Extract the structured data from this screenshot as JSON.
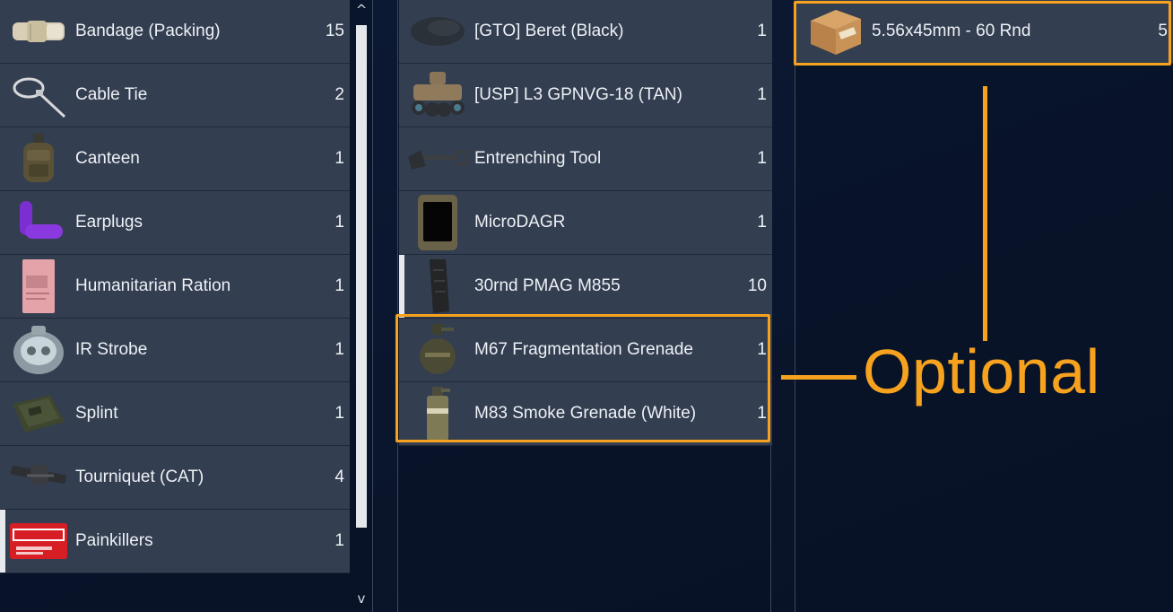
{
  "left_panel": {
    "items": [
      {
        "icon": "bandage-icon",
        "label": "Bandage (Packing)",
        "qty": "15"
      },
      {
        "icon": "cable-tie-icon",
        "label": "Cable Tie",
        "qty": "2"
      },
      {
        "icon": "canteen-icon",
        "label": "Canteen",
        "qty": "1"
      },
      {
        "icon": "earplugs-icon",
        "label": "Earplugs",
        "qty": "1"
      },
      {
        "icon": "ration-icon",
        "label": "Humanitarian Ration",
        "qty": "1"
      },
      {
        "icon": "ir-strobe-icon",
        "label": "IR Strobe",
        "qty": "1"
      },
      {
        "icon": "splint-icon",
        "label": "Splint",
        "qty": "1"
      },
      {
        "icon": "tourniquet-icon",
        "label": "Tourniquet (CAT)",
        "qty": "4"
      },
      {
        "icon": "painkillers-icon",
        "label": "Painkillers",
        "qty": "1",
        "selected": true
      }
    ],
    "scroll_up_glyph": "^",
    "scroll_down_glyph": "v"
  },
  "middle_panel": {
    "items": [
      {
        "icon": "beret-icon",
        "label": "[GTO] Beret (Black)",
        "qty": "1"
      },
      {
        "icon": "nvg-icon",
        "label": "[USP] L3 GPNVG-18 (TAN)",
        "qty": "1"
      },
      {
        "icon": "shovel-icon",
        "label": "Entrenching Tool",
        "qty": "1"
      },
      {
        "icon": "gps-device-icon",
        "label": "MicroDAGR",
        "qty": "1"
      },
      {
        "icon": "magazine-icon",
        "label": "30rnd PMAG M855",
        "qty": "10",
        "selected": true
      },
      {
        "icon": "frag-grenade-icon",
        "label": "M67 Fragmentation Grenade",
        "qty": "1"
      },
      {
        "icon": "smoke-grenade-icon",
        "label": "M83 Smoke Grenade (White)",
        "qty": "1"
      }
    ]
  },
  "right_panel": {
    "items": [
      {
        "icon": "ammo-box-icon",
        "label": "5.56x45mm - 60 Rnd",
        "qty": "5"
      }
    ]
  },
  "annotation": {
    "text": "Optional",
    "color": "#f6a21e"
  },
  "colors": {
    "row_bg": "#333e51",
    "background": "#0b1730",
    "selected_marker": "#e6e9ee"
  }
}
